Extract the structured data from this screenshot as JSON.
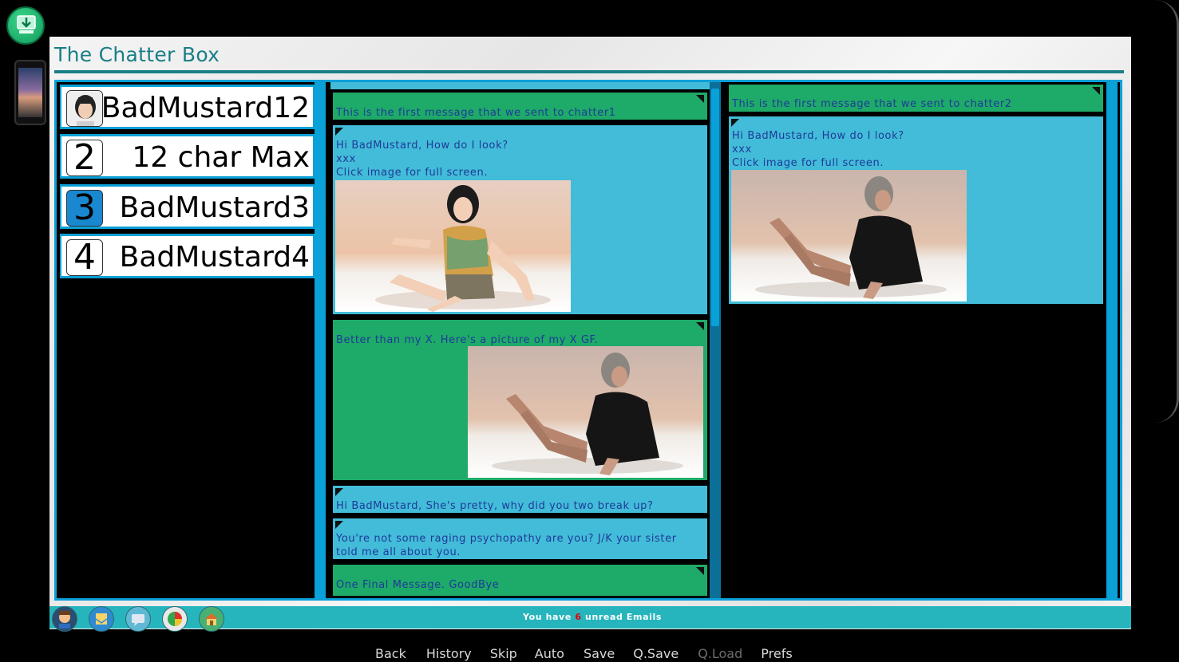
{
  "app": {
    "title": "The Chatter Box"
  },
  "contacts": [
    {
      "badge": "",
      "name": "BadMustard12",
      "avatar": true
    },
    {
      "badge": "2",
      "name": "12 char Max"
    },
    {
      "badge": "3",
      "name": "BadMustard3",
      "active": true
    },
    {
      "badge": "4",
      "name": "BadMustard4"
    }
  ],
  "chat1": {
    "messages": [
      {
        "from": "me",
        "text": "This is the first message that we sent to chatter1"
      },
      {
        "from": "them",
        "lines": [
          "Hi BadMustard, How do I look?",
          "xxx",
          "Click image for full screen."
        ]
      },
      {
        "from": "me",
        "text": "Better than my X. Here's a picture of my X GF."
      },
      {
        "from": "them",
        "text": "Hi BadMustard, She's pretty, why did you two break up?"
      },
      {
        "from": "them",
        "lines": [
          "You're not some raging psychopathy are you? J/K your sister",
          "told me all about you."
        ]
      },
      {
        "from": "me",
        "text": "One Final Message. GoodBye"
      }
    ]
  },
  "chat2": {
    "messages": [
      {
        "from": "me",
        "text": "This is the first message that we sent to chatter2"
      },
      {
        "from": "them",
        "lines": [
          "Hi BadMustard, How do I look?",
          "xxx",
          "Click image for full screen."
        ]
      }
    ]
  },
  "status": {
    "prefix": "You have",
    "count": "6",
    "suffix": "unread Emails"
  },
  "dock": [
    "avatar-icon",
    "mail-icon",
    "chat-icon",
    "stats-icon",
    "home-icon"
  ],
  "quick_menu": {
    "back": "Back",
    "history": "History",
    "skip": "Skip",
    "auto": "Auto",
    "save": "Save",
    "qsave": "Q.Save",
    "qload": "Q.Load",
    "prefs": "Prefs"
  },
  "colors": {
    "accent": "#0aa0d8",
    "sent": "#1eaa68",
    "received": "#42bcd8",
    "title": "#1a7e86",
    "statusbar": "#27b5bd"
  }
}
